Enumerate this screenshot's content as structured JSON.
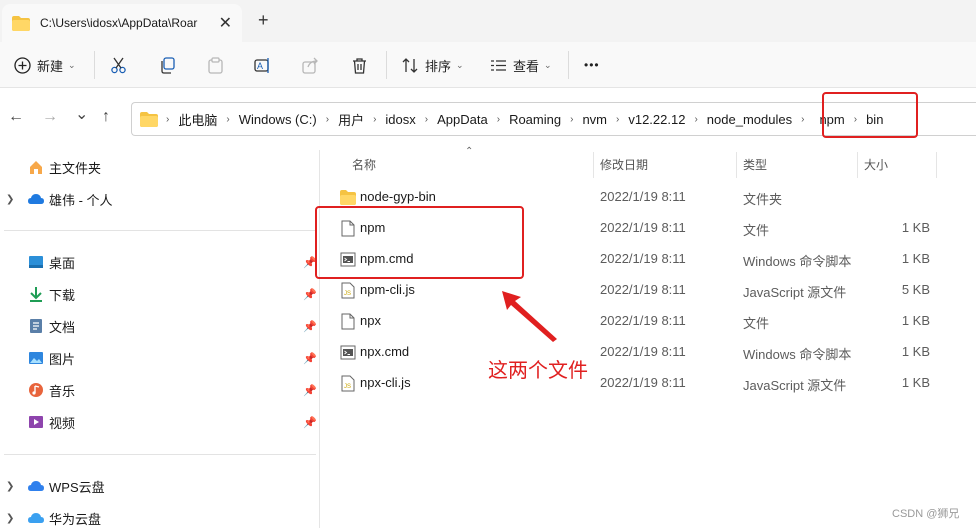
{
  "tab": {
    "title": "C:\\Users\\idosx\\AppData\\Roar",
    "close": "✕",
    "new_tab": "+"
  },
  "toolbar": {
    "new_label": "新建",
    "sort_label": "排序",
    "view_label": "查看",
    "more": "•••"
  },
  "nav_buttons": {
    "back": "←",
    "forward": "→",
    "recent": "⌄",
    "up": "↑"
  },
  "breadcrumb": [
    "此电脑",
    "Windows (C:)",
    "用户",
    "idosx",
    "AppData",
    "Roaming",
    "nvm",
    "v12.22.12",
    "node_modules",
    "npm",
    "bin"
  ],
  "sidebar": {
    "home": "主文件夹",
    "onedrive": "雄伟 - 个人",
    "quick": [
      "桌面",
      "下载",
      "文档",
      "图片",
      "音乐",
      "视频"
    ],
    "wps": "WPS云盘",
    "huawei": "华为云盘"
  },
  "columns": {
    "name": "名称",
    "date": "修改日期",
    "type": "类型",
    "size": "大小"
  },
  "files": [
    {
      "name": "node-gyp-bin",
      "date": "2022/1/19 8:11",
      "type": "文件夹",
      "size": "",
      "icon": "folder-icon"
    },
    {
      "name": "npm",
      "date": "2022/1/19 8:11",
      "type": "文件",
      "size": "1 KB",
      "icon": "file-icon"
    },
    {
      "name": "npm.cmd",
      "date": "2022/1/19 8:11",
      "type": "Windows 命令脚本",
      "size": "1 KB",
      "icon": "cmd-file-icon"
    },
    {
      "name": "npm-cli.js",
      "date": "2022/1/19 8:11",
      "type": "JavaScript 源文件",
      "size": "5 KB",
      "icon": "js-file-icon"
    },
    {
      "name": "npx",
      "date": "2022/1/19 8:11",
      "type": "文件",
      "size": "1 KB",
      "icon": "file-icon"
    },
    {
      "name": "npx.cmd",
      "date": "2022/1/19 8:11",
      "type": "Windows 命令脚本",
      "size": "1 KB",
      "icon": "cmd-file-icon"
    },
    {
      "name": "npx-cli.js",
      "date": "2022/1/19 8:11",
      "type": "JavaScript 源文件",
      "size": "1 KB",
      "icon": "js-file-icon"
    }
  ],
  "annotation": {
    "text": "这两个文件",
    "color": "#e02020"
  },
  "watermark": "CSDN @狮兄"
}
